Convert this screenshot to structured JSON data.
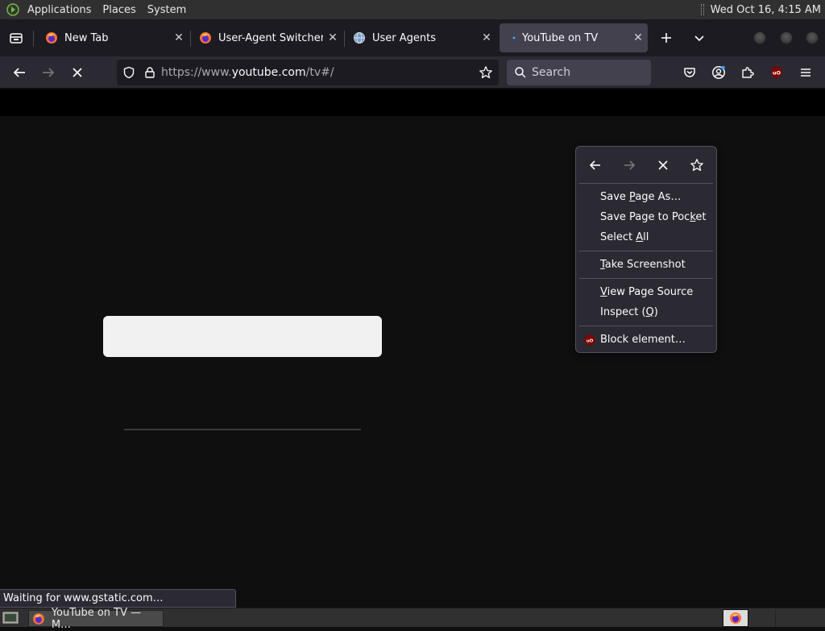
{
  "top_panel": {
    "menus": [
      "Applications",
      "Places",
      "System"
    ],
    "clock": "Wed Oct 16,  4:15 AM"
  },
  "tabs": [
    {
      "title": "New Tab",
      "icon": "firefox-icon"
    },
    {
      "title": "User-Agent Switcher –",
      "icon": "firefox-icon"
    },
    {
      "title": "User Agents",
      "icon": "globe-icon"
    },
    {
      "title": "YouTube on TV",
      "icon": "loading-dot-icon",
      "active": true
    }
  ],
  "navbar": {
    "url_prefix": "https://www.",
    "url_domain": "youtube.com",
    "url_suffix": "/tv#/",
    "search_placeholder": "Search"
  },
  "context_menu": {
    "items": [
      {
        "pre": "Save ",
        "key": "P",
        "post": "age As…"
      },
      {
        "pre": "Save Page to Poc",
        "key": "k",
        "post": "et"
      },
      {
        "pre": "Select ",
        "key": "A",
        "post": "ll"
      },
      {
        "pre": "",
        "key": "T",
        "post": "ake Screenshot"
      },
      {
        "pre": "",
        "key": "V",
        "post": "iew Page Source"
      },
      {
        "pre": "Inspect (",
        "key": "Q",
        "post": ")"
      },
      {
        "pre": "Block element…",
        "key": "",
        "post": ""
      }
    ]
  },
  "status_text": "Waiting for www.gstatic.com…",
  "taskbar": {
    "window_title": "YouTube on TV — M…"
  },
  "colors": {
    "ublock_red": "#800000",
    "page_bg": "#0f0f0f",
    "accent_loading": "#45a1ff"
  }
}
